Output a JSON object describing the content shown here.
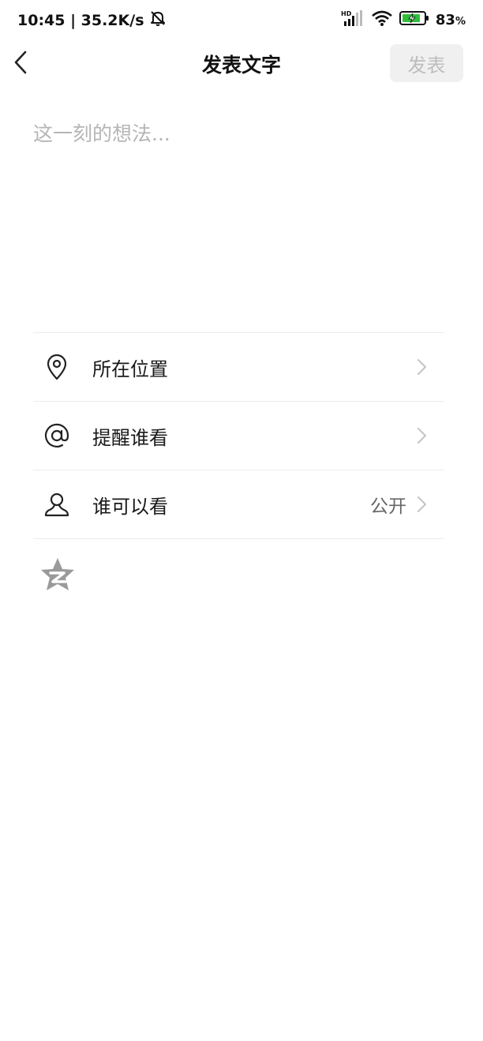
{
  "status_bar": {
    "time_speed": "10:45 | 35.2K/s",
    "battery_percent": "83",
    "battery_unit": "%"
  },
  "nav": {
    "title": "发表文字",
    "publish_label": "发表"
  },
  "composer": {
    "placeholder": "这一刻的想法...",
    "value": ""
  },
  "options": {
    "location": {
      "label": "所在位置",
      "value": ""
    },
    "mention": {
      "label": "提醒谁看",
      "value": ""
    },
    "visibility": {
      "label": "谁可以看",
      "value": "公开"
    }
  },
  "icons": {
    "back": "back-arrow-icon",
    "location": "location-pin-icon",
    "mention": "at-sign-icon",
    "visibility": "person-icon",
    "chevron": "chevron-right-icon",
    "qzone": "qzone-star-icon"
  },
  "colors": {
    "publish_bg": "#f0f0f0",
    "publish_text": "#bdbdbd",
    "placeholder": "#b5b5b5",
    "divider": "#ececec"
  }
}
